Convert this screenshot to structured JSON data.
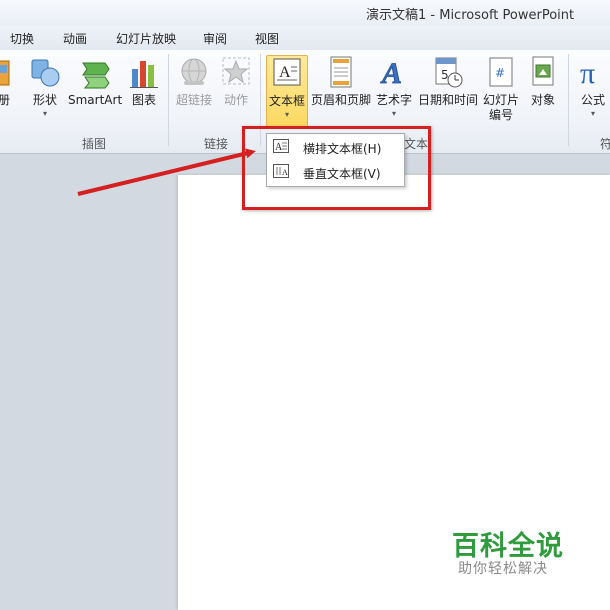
{
  "window": {
    "title": "演示文稿1 - Microsoft PowerPoint"
  },
  "tabs": [
    "切换",
    "动画",
    "幻灯片放映",
    "审阅",
    "视图"
  ],
  "ribbon": {
    "partial_left_label": "册",
    "buttons": {
      "shape": "形状",
      "smartart": "SmartArt",
      "chart": "图表",
      "hyperlink": "超链接",
      "action": "动作",
      "textbox": "文本框",
      "header_footer": "页眉和页脚",
      "wordart": "艺术字",
      "datetime": "日期和时间",
      "slide_number_line1": "幻灯片",
      "slide_number_line2": "编号",
      "object": "对象",
      "equation": "公式"
    },
    "groups": {
      "illustrations": "插图",
      "links": "链接",
      "text": "文本",
      "symbols_partial": "符"
    },
    "arrow_glyph": "▾"
  },
  "textbox_menu": {
    "items": [
      "横排文本框(H)",
      "垂直文本框(V)"
    ]
  },
  "watermark": {
    "title": "百科全说",
    "subtitle": "助你轻松解决"
  },
  "colors": {
    "highlight_box": "#d42020",
    "watermark_green": "#2f9b3c",
    "active_button": "#fcd860"
  }
}
